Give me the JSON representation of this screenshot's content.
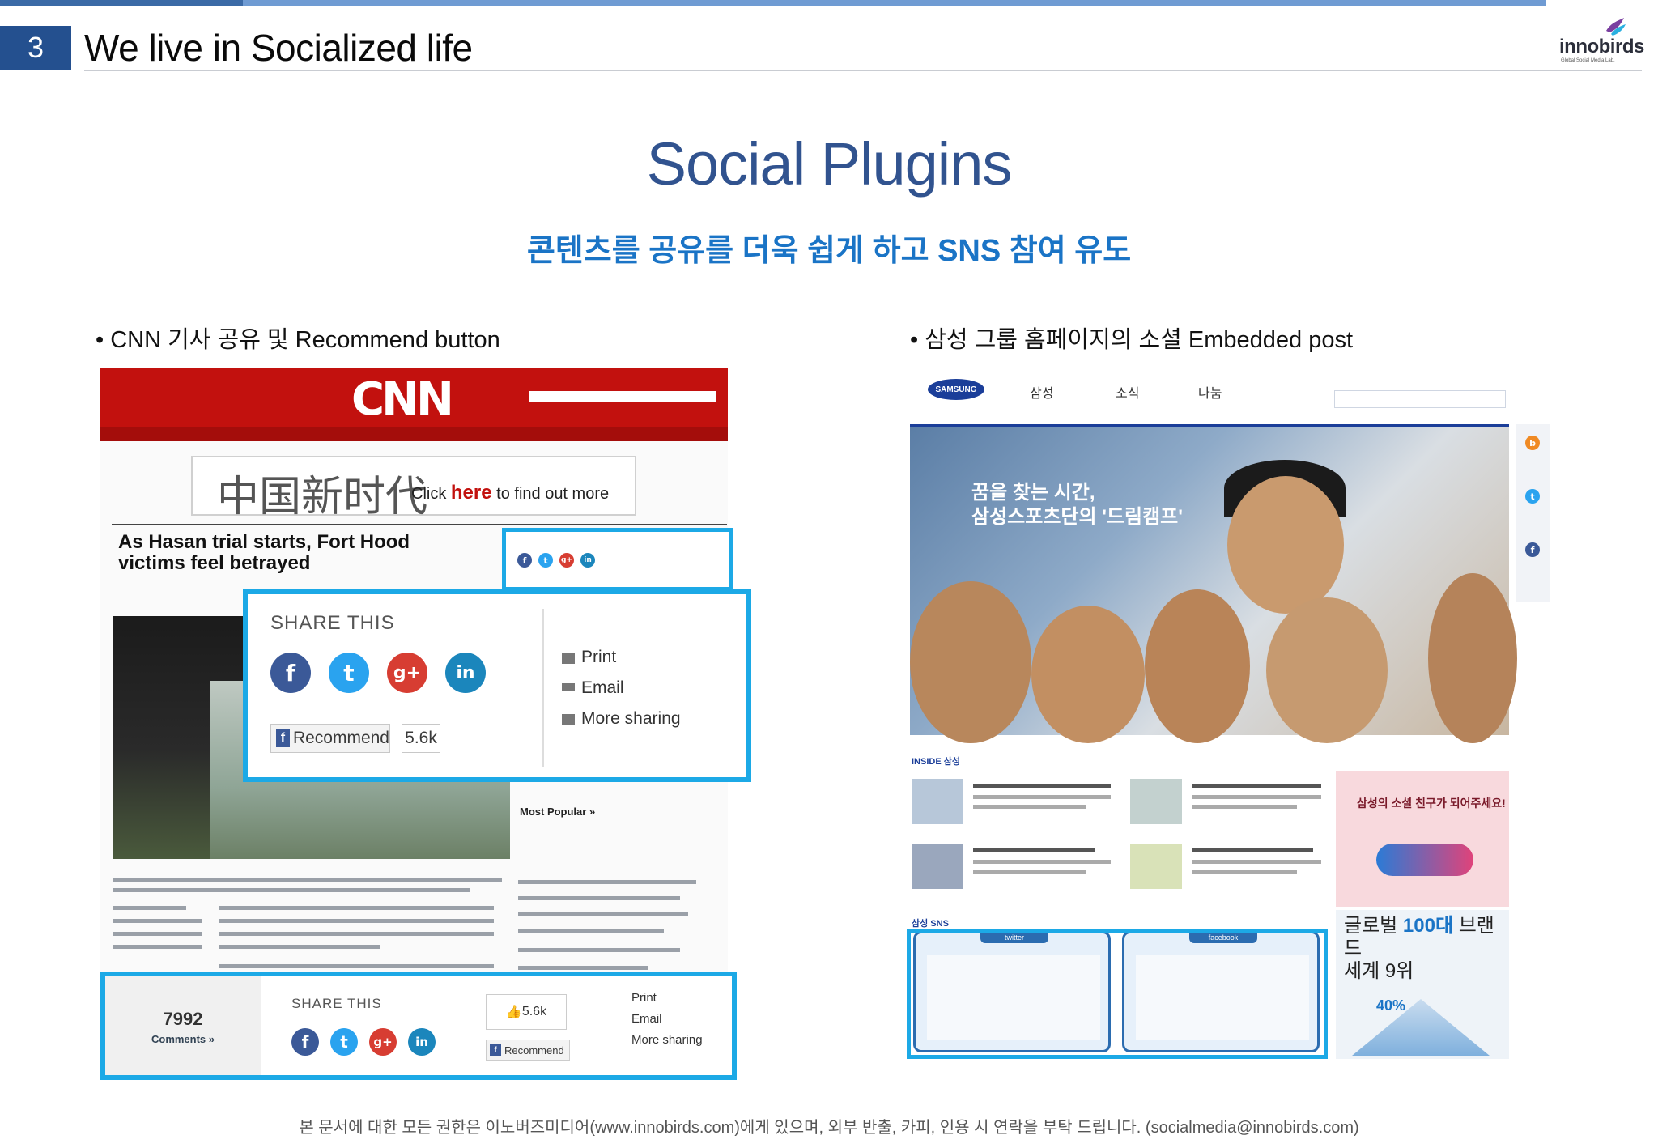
{
  "slide": {
    "number": "3",
    "title": "We live in Socialized life",
    "logo_text": "innobirds",
    "logo_subtext": "Global Social Media Lab.",
    "heading": "Social Plugins",
    "subheading": "콘텐츠를 공유를 더욱 쉽게 하고 SNS 참여 유도",
    "footer": "본 문서에 대한 모든 권한은 이노버즈미디어(www.innobirds.com)에게 있으며, 외부 반출, 카피, 인용 시 연락을 부탁 드립니다. (socialmedia@innobirds.com)"
  },
  "left": {
    "bullet": "•   CNN 기사 공유 및 Recommend button",
    "cnn_logo": "CNN",
    "ad_text": "Click ",
    "ad_here": "here",
    "ad_tail": " to find out more",
    "ad_glyph": "中国新时代",
    "headline": "As Hasan trial starts, Fort Hood victims feel betrayed",
    "most_popular": "Most Popular »",
    "share_big": {
      "label": "SHARE THIS",
      "print": "Print",
      "email": "Email",
      "more": "More sharing",
      "recommend": "Recommend",
      "count": "5.6k"
    },
    "share_bottom": {
      "comments_count": "7992",
      "comments_label": "Comments »",
      "label": "SHARE THIS",
      "likes": "5.6k",
      "recommend": "Recommend",
      "print": "Print",
      "email": "Email",
      "more": "More sharing"
    }
  },
  "right": {
    "bullet": "•   삼성 그룹 홈페이지의 소셜 Embedded post",
    "samsung_logo": "SAMSUNG",
    "nav": [
      "삼성",
      "소식",
      "나눔"
    ],
    "hero_text": "꿈을 찾는 시간,\n삼성스포츠단의 '드림캠프'",
    "inside_label": "INSIDE 삼성",
    "sns_label": "삼성 SNS",
    "twitter_tab": "twitter",
    "facebook_tab": "facebook",
    "promo_text": "삼성의 소셜 친구가 되어주세요!",
    "brand_title_1": "글로벌 ",
    "brand_title_bold": "100대",
    "brand_title_2": " 브랜드",
    "brand_title_3": "세계 9위",
    "brand_pct": "40%"
  }
}
